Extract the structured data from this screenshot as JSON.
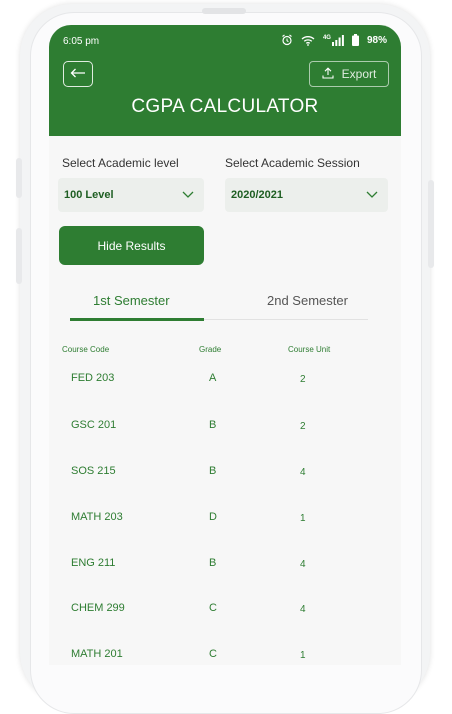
{
  "status_bar": {
    "time": "6:05 pm",
    "network": "4G",
    "battery": "98%"
  },
  "header": {
    "title": "CGPA CALCULATOR",
    "export_label": "Export"
  },
  "filters": {
    "level_label": "Select Academic level",
    "level_value": "100 Level",
    "session_label": "Select Academic Session",
    "session_value": "2020/2021"
  },
  "hide_results_label": "Hide Results",
  "tabs": [
    {
      "label": "1st Semester",
      "active": true
    },
    {
      "label": "2nd Semester",
      "active": false
    }
  ],
  "table": {
    "headers": [
      "Course Code",
      "Grade",
      "Course Unit"
    ],
    "rows": [
      {
        "code": "FED 203",
        "grade": "A",
        "unit": "2"
      },
      {
        "code": "GSC 201",
        "grade": "B",
        "unit": "2"
      },
      {
        "code": "SOS 215",
        "grade": "B",
        "unit": "4"
      },
      {
        "code": "MATH 203",
        "grade": "D",
        "unit": "1"
      },
      {
        "code": "ENG 211",
        "grade": "B",
        "unit": "4"
      },
      {
        "code": "CHEM 299",
        "grade": "C",
        "unit": "4"
      },
      {
        "code": "MATH 201",
        "grade": "C",
        "unit": "1"
      }
    ]
  },
  "colors": {
    "primary": "#2e7d32",
    "background": "#f7f7f7",
    "select_bg": "#ecefec"
  }
}
